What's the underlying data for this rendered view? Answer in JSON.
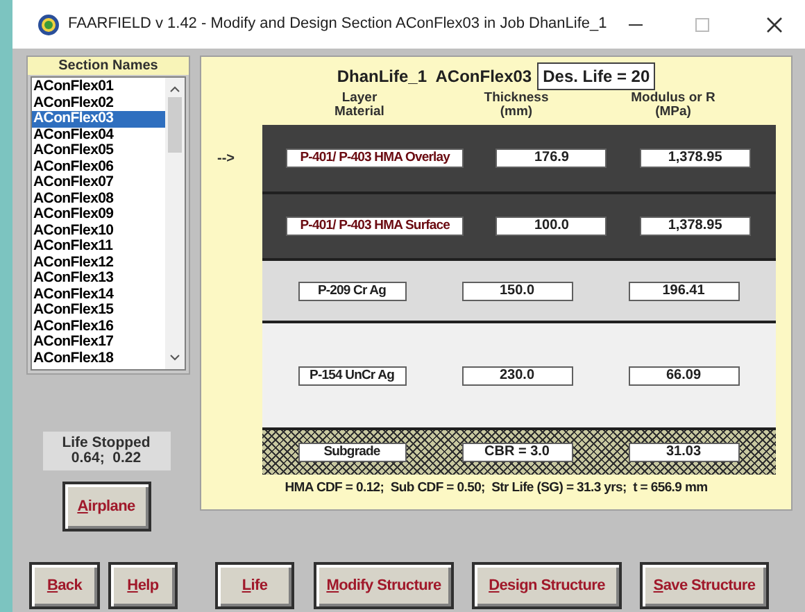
{
  "window": {
    "title": "FAARFIELD v 1.42 - Modify and Design Section AConFlex03 in Job DhanLife_1"
  },
  "sections": {
    "header": "Section Names",
    "items": [
      {
        "label": "AConFlex01",
        "selected": false
      },
      {
        "label": "AConFlex02",
        "selected": false
      },
      {
        "label": "AConFlex03",
        "selected": true
      },
      {
        "label": "AConFlex04",
        "selected": false
      },
      {
        "label": "AConFlex05",
        "selected": false
      },
      {
        "label": "AConFlex06",
        "selected": false
      },
      {
        "label": "AConFlex07",
        "selected": false
      },
      {
        "label": "AConFlex08",
        "selected": false
      },
      {
        "label": "AConFlex09",
        "selected": false
      },
      {
        "label": "AConFlex10",
        "selected": false
      },
      {
        "label": "AConFlex11",
        "selected": false
      },
      {
        "label": "AConFlex12",
        "selected": false
      },
      {
        "label": "AConFlex13",
        "selected": false
      },
      {
        "label": "AConFlex14",
        "selected": false
      },
      {
        "label": "AConFlex15",
        "selected": false
      },
      {
        "label": "AConFlex16",
        "selected": false
      },
      {
        "label": "AConFlex17",
        "selected": false
      },
      {
        "label": "AConFlex18",
        "selected": false
      }
    ]
  },
  "life_stopped": {
    "label": "Life Stopped",
    "value": "0.64;  0.22"
  },
  "structure": {
    "job": "DhanLife_1",
    "section": "AConFlex03",
    "design_life": "Des. Life = 20",
    "columns": [
      "Layer\nMaterial",
      "Thickness\n(mm)",
      "Modulus or R\n(MPa)"
    ],
    "pointer": "-->",
    "layers": [
      {
        "kind": "asphalt",
        "selected": true,
        "material": "P-401/ P-403 HMA Overlay",
        "thickness": "176.9",
        "modulus": "1,378.95"
      },
      {
        "kind": "asphalt",
        "selected": false,
        "material": "P-401/ P-403 HMA Surface",
        "thickness": "100.0",
        "modulus": "1,378.95"
      },
      {
        "kind": "crushed",
        "selected": false,
        "material": "P-209 Cr Ag",
        "thickness": "150.0",
        "modulus": "196.41"
      },
      {
        "kind": "uncrushed",
        "selected": false,
        "material": "P-154 UnCr Ag",
        "thickness": "230.0",
        "modulus": "66.09"
      },
      {
        "kind": "subgrade",
        "selected": false,
        "material": "Subgrade",
        "thickness": "CBR = 3.0",
        "modulus": "31.03"
      }
    ],
    "summary": "HMA CDF = 0.12;  Sub CDF = 0.50;  Str Life (SG) = 31.3 yrs;  t = 656.9 mm"
  },
  "airplane_button": "Airplane",
  "buttons": [
    "Back",
    "Help",
    "Life",
    "Modify Structure",
    "Design Structure",
    "Save Structure"
  ]
}
